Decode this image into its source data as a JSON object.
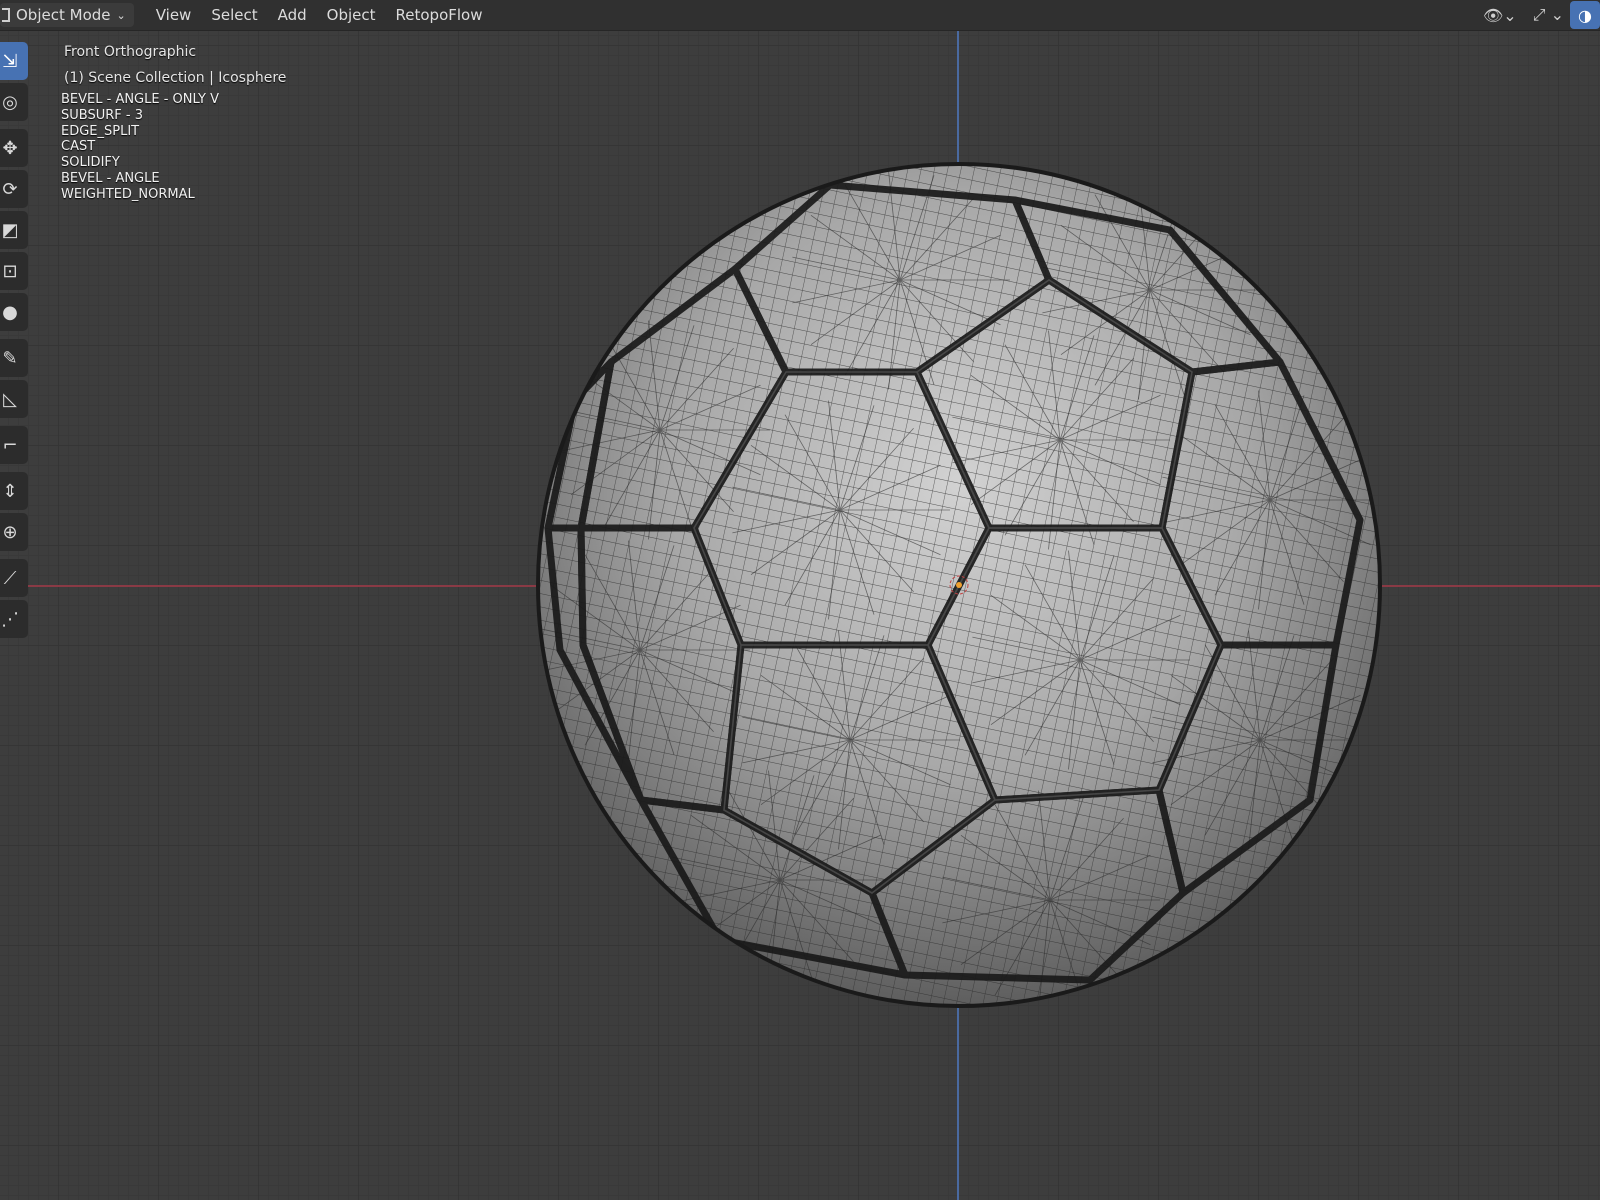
{
  "header": {
    "mode_label": "Object Mode",
    "menus": [
      "View",
      "Select",
      "Add",
      "Object",
      "RetopoFlow"
    ]
  },
  "overlay": {
    "view_name": "Front Orthographic",
    "collection": "(1) Scene Collection | Icosphere",
    "modifiers": [
      "BEVEL - ANGLE - ONLY V",
      "SUBSURF - 3",
      "EDGE_SPLIT",
      "CAST",
      "SOLIDIFY",
      "BEVEL - ANGLE",
      "WEIGHTED_NORMAL"
    ]
  },
  "toolbar": {
    "tools": [
      {
        "name": "select-box-tool",
        "icon": "select-box-icon",
        "glyph": "⇲",
        "active": true
      },
      {
        "name": "cursor-tool",
        "icon": "cursor-icon",
        "glyph": "◎"
      },
      {
        "name": "move-tool",
        "icon": "move-icon",
        "glyph": "✥"
      },
      {
        "name": "rotate-tool",
        "icon": "rotate-icon",
        "glyph": "⟳"
      },
      {
        "name": "scale-tool",
        "icon": "scale-icon",
        "glyph": "◩"
      },
      {
        "name": "transform-tool",
        "icon": "transform-icon",
        "glyph": "⊡"
      },
      {
        "name": "none-tool",
        "icon": "none-icon",
        "glyph": "●"
      },
      {
        "name": "annotate-tool",
        "icon": "annotate-icon",
        "glyph": "✎"
      },
      {
        "name": "measure-tool",
        "icon": "measure-icon",
        "glyph": "◺"
      },
      {
        "name": "bend-tool",
        "icon": "bend-icon",
        "glyph": "⌐"
      },
      {
        "name": "push-pull-tool",
        "icon": "push-pull-icon",
        "glyph": "⇕"
      },
      {
        "name": "spin-tool",
        "icon": "spin-icon",
        "glyph": "⊕"
      },
      {
        "name": "knife-tool",
        "icon": "knife-icon",
        "glyph": "⟋"
      },
      {
        "name": "edge-tool",
        "icon": "edge-icon",
        "glyph": "⋰"
      }
    ]
  },
  "header_right_icons": [
    "visibility-icon",
    "gizmo-icon",
    "overlay-icon"
  ],
  "colors": {
    "background": "#3d3d3d",
    "header": "#303030",
    "accent": "#4772b3",
    "x_axis": "#8a3a45",
    "z_axis": "#4a6aa0"
  }
}
